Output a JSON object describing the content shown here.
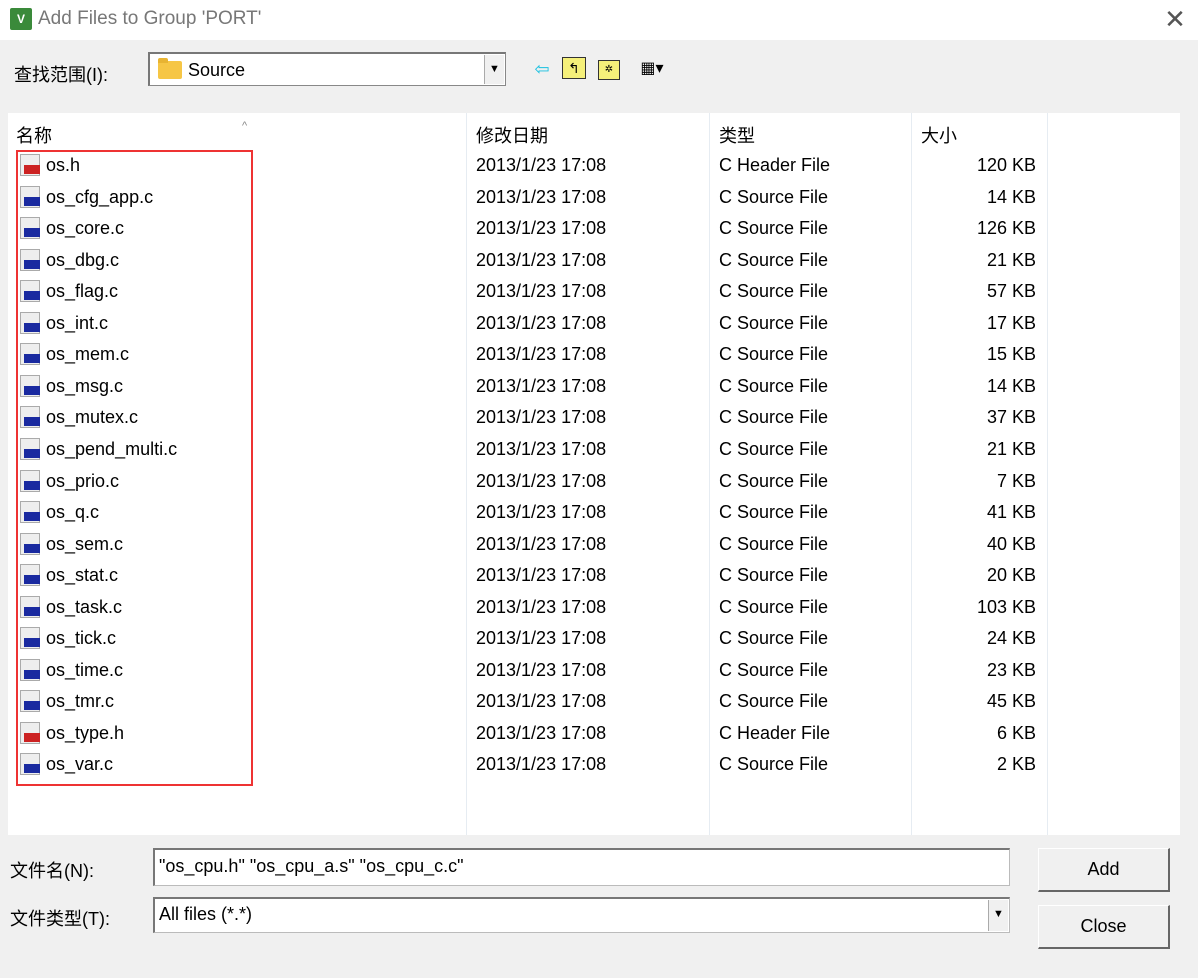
{
  "window": {
    "title": "Add Files to Group 'PORT'",
    "icon": "uvision-icon"
  },
  "toolbar": {
    "look_in_label": "查找范围(I):",
    "look_in_value": "Source",
    "icons": [
      "back-arrow-icon",
      "up-folder-icon",
      "new-folder-icon",
      "view-menu-icon"
    ]
  },
  "list": {
    "columns": [
      "名称",
      "修改日期",
      "类型",
      "大小"
    ],
    "files": [
      {
        "name": "os.h",
        "date": "2013/1/23 17:08",
        "type": "C Header File",
        "size": "120 KB"
      },
      {
        "name": "os_cfg_app.c",
        "date": "2013/1/23 17:08",
        "type": "C Source File",
        "size": "14 KB"
      },
      {
        "name": "os_core.c",
        "date": "2013/1/23 17:08",
        "type": "C Source File",
        "size": "126 KB"
      },
      {
        "name": "os_dbg.c",
        "date": "2013/1/23 17:08",
        "type": "C Source File",
        "size": "21 KB"
      },
      {
        "name": "os_flag.c",
        "date": "2013/1/23 17:08",
        "type": "C Source File",
        "size": "57 KB"
      },
      {
        "name": "os_int.c",
        "date": "2013/1/23 17:08",
        "type": "C Source File",
        "size": "17 KB"
      },
      {
        "name": "os_mem.c",
        "date": "2013/1/23 17:08",
        "type": "C Source File",
        "size": "15 KB"
      },
      {
        "name": "os_msg.c",
        "date": "2013/1/23 17:08",
        "type": "C Source File",
        "size": "14 KB"
      },
      {
        "name": "os_mutex.c",
        "date": "2013/1/23 17:08",
        "type": "C Source File",
        "size": "37 KB"
      },
      {
        "name": "os_pend_multi.c",
        "date": "2013/1/23 17:08",
        "type": "C Source File",
        "size": "21 KB"
      },
      {
        "name": "os_prio.c",
        "date": "2013/1/23 17:08",
        "type": "C Source File",
        "size": "7 KB"
      },
      {
        "name": "os_q.c",
        "date": "2013/1/23 17:08",
        "type": "C Source File",
        "size": "41 KB"
      },
      {
        "name": "os_sem.c",
        "date": "2013/1/23 17:08",
        "type": "C Source File",
        "size": "40 KB"
      },
      {
        "name": "os_stat.c",
        "date": "2013/1/23 17:08",
        "type": "C Source File",
        "size": "20 KB"
      },
      {
        "name": "os_task.c",
        "date": "2013/1/23 17:08",
        "type": "C Source File",
        "size": "103 KB"
      },
      {
        "name": "os_tick.c",
        "date": "2013/1/23 17:08",
        "type": "C Source File",
        "size": "24 KB"
      },
      {
        "name": "os_time.c",
        "date": "2013/1/23 17:08",
        "type": "C Source File",
        "size": "23 KB"
      },
      {
        "name": "os_tmr.c",
        "date": "2013/1/23 17:08",
        "type": "C Source File",
        "size": "45 KB"
      },
      {
        "name": "os_type.h",
        "date": "2013/1/23 17:08",
        "type": "C Header File",
        "size": "6 KB"
      },
      {
        "name": "os_var.c",
        "date": "2013/1/23 17:08",
        "type": "C Source File",
        "size": "2 KB"
      }
    ],
    "highlight_color": "#e33333"
  },
  "footer": {
    "filename_label": "文件名(N):",
    "filename_value": "\"os_cpu.h\" \"os_cpu_a.s\" \"os_cpu_c.c\"",
    "filetype_label": "文件类型(T):",
    "filetype_value": "All files (*.*)",
    "add_label": "Add",
    "close_label": "Close"
  },
  "colors": {
    "header_icon": "#cc2222",
    "source_icon": "#1a2aa0"
  }
}
